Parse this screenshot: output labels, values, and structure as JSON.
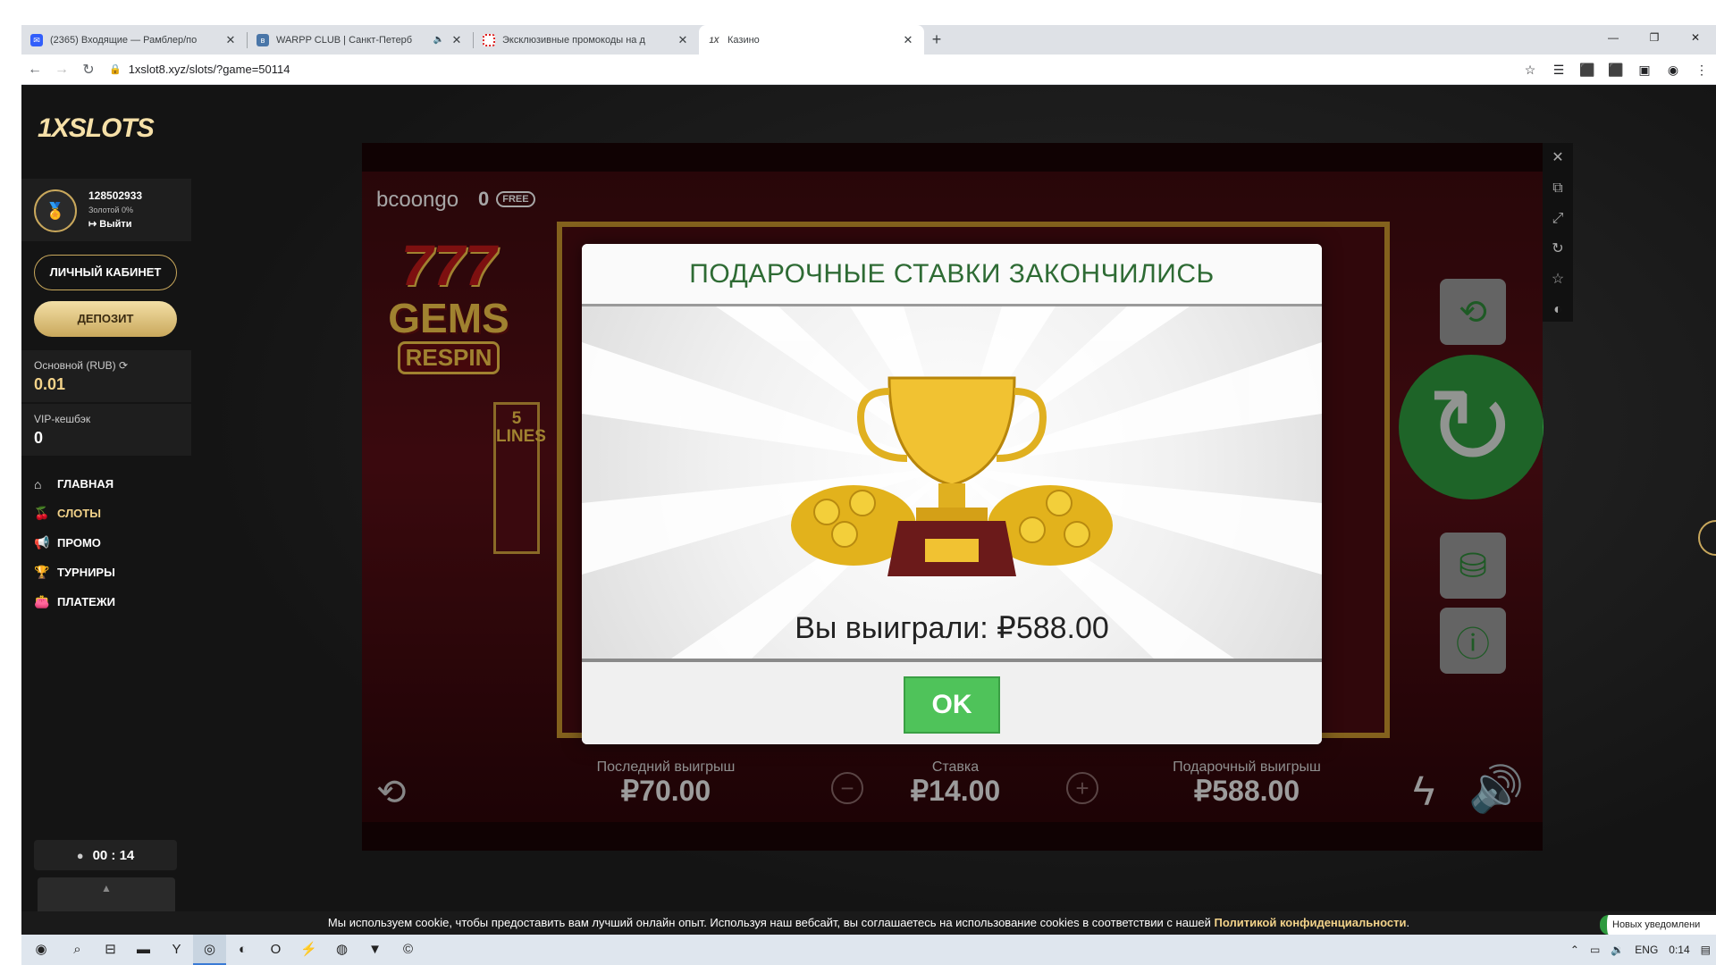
{
  "browser": {
    "tabs": [
      {
        "title": "(2365) Входящие — Рамблер/по",
        "color": "#315efb"
      },
      {
        "title": "WARPP CLUB | Санкт-Петерб",
        "color": "#4a76a8"
      },
      {
        "title": "Эксклюзивные промокоды на д",
        "color": "#d22"
      },
      {
        "title": "Казино",
        "color": "#555"
      }
    ],
    "url": "1xslot8.xyz/slots/?game=50114"
  },
  "site": {
    "logo": "1XSLOTS",
    "user_id": "128502933",
    "rank": "Золотой 0%",
    "logout": "Выйти",
    "cabinet_button": "ЛИЧНЫЙ КАБИНЕТ",
    "deposit_button": "ДЕПОЗИТ",
    "balance_label": "Основной (RUB)",
    "balance_value": "0.01",
    "vip_label": "VIP-кешбэк",
    "vip_value": "0",
    "menu": [
      {
        "label": "ГЛАВНАЯ",
        "icon": "home-icon"
      },
      {
        "label": "СЛОТЫ",
        "icon": "cherries-icon"
      },
      {
        "label": "ПРОМО",
        "icon": "megaphone-icon"
      },
      {
        "label": "ТУРНИРЫ",
        "icon": "trophy-icon"
      },
      {
        "label": "ПЛАТЕЖИ",
        "icon": "wallet-icon"
      }
    ],
    "timer": "00 : 14"
  },
  "game": {
    "provider": "bcoongo",
    "free_count": "0",
    "free_badge": "FREE",
    "title_num": "777",
    "title_gems": "GEMS",
    "title_respin": "RESPIN",
    "lines": "5 LINES",
    "last_win_label": "Последний выигрыш",
    "last_win_value": "₽70.00",
    "bet_label": "Ставка",
    "bet_value": "₽14.00",
    "gift_win_label": "Подарочный выигрыш",
    "gift_win_value": "₽588.00"
  },
  "modal": {
    "title": "ПОДАРОЧНЫЕ СТАВКИ ЗАКОНЧИЛИСЬ",
    "message": "Вы выиграли: ₽588.00",
    "ok": "OK"
  },
  "cookie": {
    "text": "Мы используем cookie, чтобы предоставить вам лучший онлайн опыт. Используя наш вебсайт, вы соглашаетесь на использование cookies в соответствии с нашей",
    "policy": "Политикой конфиденциальности",
    "dot": "."
  },
  "notification": "Новых уведомлени",
  "tray": {
    "lang": "ENG",
    "time": "0:14"
  },
  "colors": {
    "accent_gold": "#c9a85c",
    "game_green": "#2e9a3e",
    "modal_title": "#2e6b34"
  }
}
